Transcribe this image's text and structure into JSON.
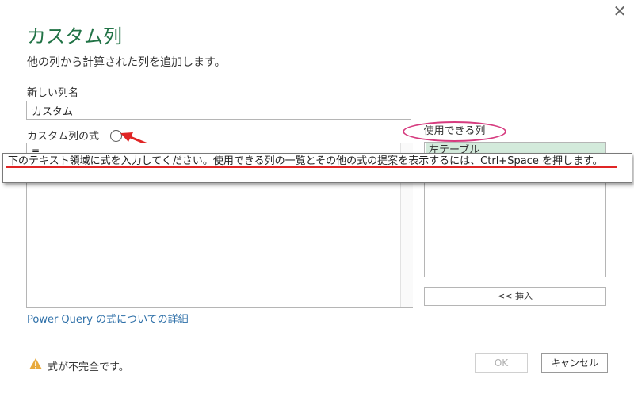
{
  "dialog": {
    "title": "カスタム列",
    "subtitle": "他の列から計算された列を追加します。",
    "close_icon": "close-icon"
  },
  "name_field": {
    "label": "新しい列名",
    "value": "カスタム"
  },
  "formula": {
    "label": "カスタム列の式",
    "info_icon": "info-icon",
    "value": "="
  },
  "available_columns": {
    "label": "使用できる列",
    "items": [
      "左テーブル"
    ],
    "insert_label": "<< 挿入"
  },
  "tooltip": {
    "text": "下のテキスト領域に式を入力してください。使用できる列の一覧とその他の式の提案を表示するには、Ctrl+Space を押します。"
  },
  "footer": {
    "link": "Power Query の式についての詳細",
    "warning_icon": "warning-icon",
    "warning": "式が不完全です。",
    "ok_label": "OK",
    "cancel_label": "キャンセル"
  },
  "colors": {
    "title": "#217346",
    "link": "#2d6fa8",
    "annotation": "#e02525",
    "highlight_ellipse": "#d63b7f",
    "column_selected": "#d3eadb"
  }
}
